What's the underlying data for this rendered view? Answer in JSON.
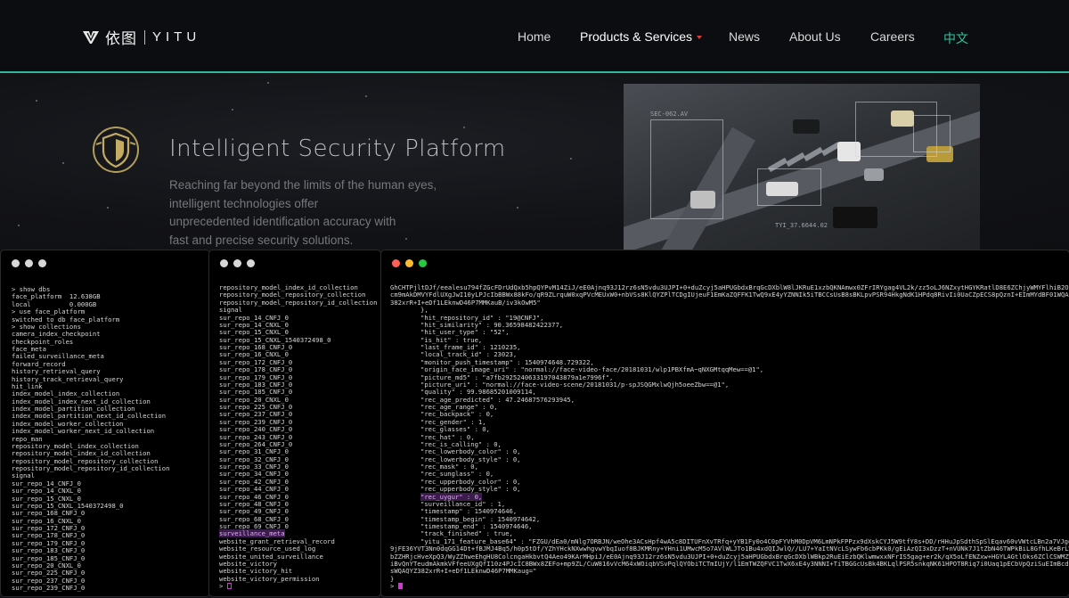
{
  "header": {
    "logo_cn": "依图",
    "logo_en": "YITU",
    "nav": [
      "Home",
      "Products & Services",
      "News",
      "About Us",
      "Careers",
      "中文"
    ],
    "accent_color": "#2fb99a"
  },
  "hero": {
    "icon": "shield-icon",
    "title": "Intelligent Security Platform",
    "desc": [
      "Reaching far beyond the limits of the human eyes,",
      "intelligent technologies offer",
      "unprecedented identification accuracy with",
      "fast and precise security solutions."
    ],
    "photo_label": "SEC-062.AV",
    "photo_tag": "TYI_37.6644.02"
  },
  "terminal1": {
    "pre": [
      "> show dbs",
      "face_platform  12.638GB",
      "local          0.000GB",
      "> use face_platform",
      "switched to db face_platform",
      "> show collections"
    ],
    "lines": [
      "camera_index_checkpoint",
      "checkpoint_roles",
      "face_meta",
      "failed_surveillance_meta",
      "forward_record",
      "history_retrieval_query",
      "history_track_retrieval_query",
      "hit_link",
      "index_model_index_collection",
      "index_model_index_next_id_collection",
      "index_model_partition_collection",
      "index_model_partition_next_id_collection",
      "index_model_worker_collection",
      "index_model_worker_next_id_collection",
      "repo_man",
      "repository_model_index_collection",
      "repository_model_index_id_collection",
      "repository_model_repository_collection",
      "repository_model_repository_id_collection",
      "signal",
      "sur_repo_14_CNFJ_0",
      "sur_repo_14_CNXL_0",
      "sur_repo_15_CNXL_0",
      "sur_repo_15_CNXL_1540372498_0",
      "sur_repo_168_CNFJ_0",
      "sur_repo_16_CNXL_0",
      "sur_repo_172_CNFJ_0",
      "sur_repo_178_CNFJ_0",
      "sur_repo_179_CNFJ_0",
      "sur_repo_183_CNFJ_0",
      "sur_repo_185_CNFJ_0",
      "sur_repo_20_CNXL_0",
      "sur_repo_225_CNFJ_0",
      "sur_repo_237_CNFJ_0",
      "sur_repo_239_CNFJ_0"
    ]
  },
  "terminal2": {
    "lines_before": [
      "repository_model_index_id_collection",
      "repository_model_repository_collection",
      "repository_model_repository_id_collection",
      "signal",
      "sur_repo_14_CNFJ_0",
      "sur_repo_14_CNXL_0",
      "sur_repo_15_CNXL_0",
      "sur_repo_15_CNXL_1540372498_0",
      "sur_repo_168_CNFJ_0",
      "sur_repo_16_CNXL_0",
      "sur_repo_172_CNFJ_0",
      "sur_repo_178_CNFJ_0",
      "sur_repo_179_CNFJ_0",
      "sur_repo_183_CNFJ_0",
      "sur_repo_185_CNFJ_0",
      "sur_repo_20_CNXL_0",
      "sur_repo_225_CNFJ_0",
      "sur_repo_237_CNFJ_0",
      "sur_repo_239_CNFJ_0",
      "sur_repo_240_CNFJ_0",
      "sur_repo_243_CNFJ_0",
      "sur_repo_264_CNFJ_0",
      "sur_repo_31_CNFJ_0",
      "sur_repo_32_CNFJ_0",
      "sur_repo_33_CNFJ_0",
      "sur_repo_34_CNFJ_0",
      "sur_repo_42_CNFJ_0",
      "sur_repo_44_CNFJ_0",
      "sur_repo_46_CNFJ_0",
      "sur_repo_48_CNFJ_0",
      "sur_repo_49_CNFJ_0",
      "sur_repo_68_CNFJ_0",
      "sur_repo_69_CNFJ_0"
    ],
    "highlight": "surveillance_meta",
    "lines_after": [
      "website_grant_retrieval_record",
      "website_resource_used_log",
      "website_united_surveillance",
      "website_victory",
      "website_victory_hit",
      "website_victory_permission"
    ],
    "prompt": ">"
  },
  "terminal3": {
    "dot_colors": [
      "#ff5f57",
      "#febc2e",
      "#28c840"
    ],
    "head": [
      "GhCHTPjltDJf/eealesu794fZGcFDrUdQxb5hpQYPvM14ZiJ/eE0Ajnq93J12rz6sN5vdu3UJPI+0+duZcyj5aHPUGbdxBrqGcDXblW8lJKRuE1xzbQKNAmwx0ZFrIRYgag4VL2k/zz5oLJ6NZxytHGYKRatlD8E6ZChjyWMYFlhiB2OnYT",
      "cm9mAkDMVYFdlUXgJwI10yLPJcIbBBWx88kFo/qR9ZLrquW0xqPVcMEUxW0+nbVSs8KlQYZPlTCDgIUjeuF1EmKaZQFFK1TwQ9xE4yYZNNIk5iTBCCsUsB8sBKLpvPSR94HkgNdK1HPdq8RivIi0UaCZpECS8pQznI+EImMYdBF01WQAVOJ",
      "382xrR+I+eDf1LEknwD46P7MMKauB/iv3kOwM5\""
    ],
    "fields": [
      "},",
      "\"hit_repository_id\" : \"19@CNFJ\",",
      "\"hit_similarity\" : 90.36598482422377,",
      "\"hit_user_type\" : \"52\",",
      "\"is_hit\" : true,",
      "\"last_frame_id\" : 1210235,",
      "\"local_track_id\" : 23023,",
      "\"monitor_push_timestamp\" : 1540974648.729322,",
      "\"origin_face_image_uri\" : \"normal://face-video-face/20181031/wlp1PBXfmA~qNXGMtqqMew==@1\",",
      "\"picture_md5\" : \"a7fb2925240633197043879a1e7996f\",",
      "\"picture_uri\" : \"normal://face-video-scene/20181031/p-spJSQGMxlwQjh5oeeZbw==@1\",",
      "\"quality\" : 99.98685201009114,",
      "\"rec_age_predicted\" : 47.24687576293945,",
      "\"rec_age_range\" : 0,",
      "\"rec_backpack\" : 0,",
      "\"rec_gender\" : 1,",
      "\"rec_glasses\" : 0,",
      "\"rec_hat\" : 0,",
      "\"rec_is_calling\" : 0,",
      "\"rec_lowerbody_color\" : 0,",
      "\"rec_lowerbody_style\" : 0,",
      "\"rec_mask\" : 0,",
      "\"rec_sunglass\" : 0,",
      "\"rec_upperbody_color\" : 0,",
      "\"rec_upperbody_style\" : 0,"
    ],
    "highlight": "\"rec_uygur\" : 0,",
    "fields_after": [
      "\"surveillance_id\" : 1,",
      "\"timestamp\" : 1540974646,",
      "\"timestamp_begin\" : 1540974642,",
      "\"timestamp_end\" : 1540974646,",
      "\"track_finished\" : true,",
      "\"yitu_171_feature_base64\" : \"FZGU/dEa0/mNlg7ORBJN/weOhe3ACsHpf4wA5c8DITUFnXvTRfq+yYB1Fy0o4C0pFYVhM0DpVM6LmNPkFPPzx9dXskCYJ5W9tfY8s+DD/rHHuJpSdthSpSlEqav60vVWtcLBn2a7VJgoNl"
    ],
    "tail": [
      "9jFE36YVT3Nn0dqGG14Dt+fBJMJ4Bq5/h0p5tDf/YZhYHckNXwwhgvwYbqIuof8BJKMRny+YHni1UMwcM5o7AVlWLJTo1Bu4xdQIJwlQ//LU7+YaItNVcLSywFb6cbPKk0/gEiAzQI3xDzzT+nVUNk7J1tZbN46TWPkBiL8GfhLKeBrLWsfx",
      "bZZHRjcHveXpQ3/WyZZhweEhgHU8ColcngaHkbvtQ4Aeo49KArMHpiJ/eE0Ajnq93J12rz6sN5vdu3UJPI+0+duZcyj5aHPUGbdxBrqGcDXblWBkp2RuEiEzbQKlwmwxxNFrIS5gag+er2k/qX5oLfENZxw+HGYLAGtlOks6ZClCSWMZWNh",
      "iBvQnYTeudmAkmkVFfeeUXgQfI10z4PJcIC8BWx8ZEFo+mp9ZL/CuW816vVcM64xWOiqbVSvPqlQYObiTCTmIUjY/l1EmTWZQFVC1TwX6xE4y3NNNI+TiTBGGcUsBk4BKLqlPSR5snkqNK61HPOT8Riq7i0Uaq1pECbVpQziSuEImBcdBF6",
      "sWQAQYZ382xrR+I+eDf1LEknwD46P7MMKaug=\"",
      "}"
    ],
    "prompt": ">"
  }
}
